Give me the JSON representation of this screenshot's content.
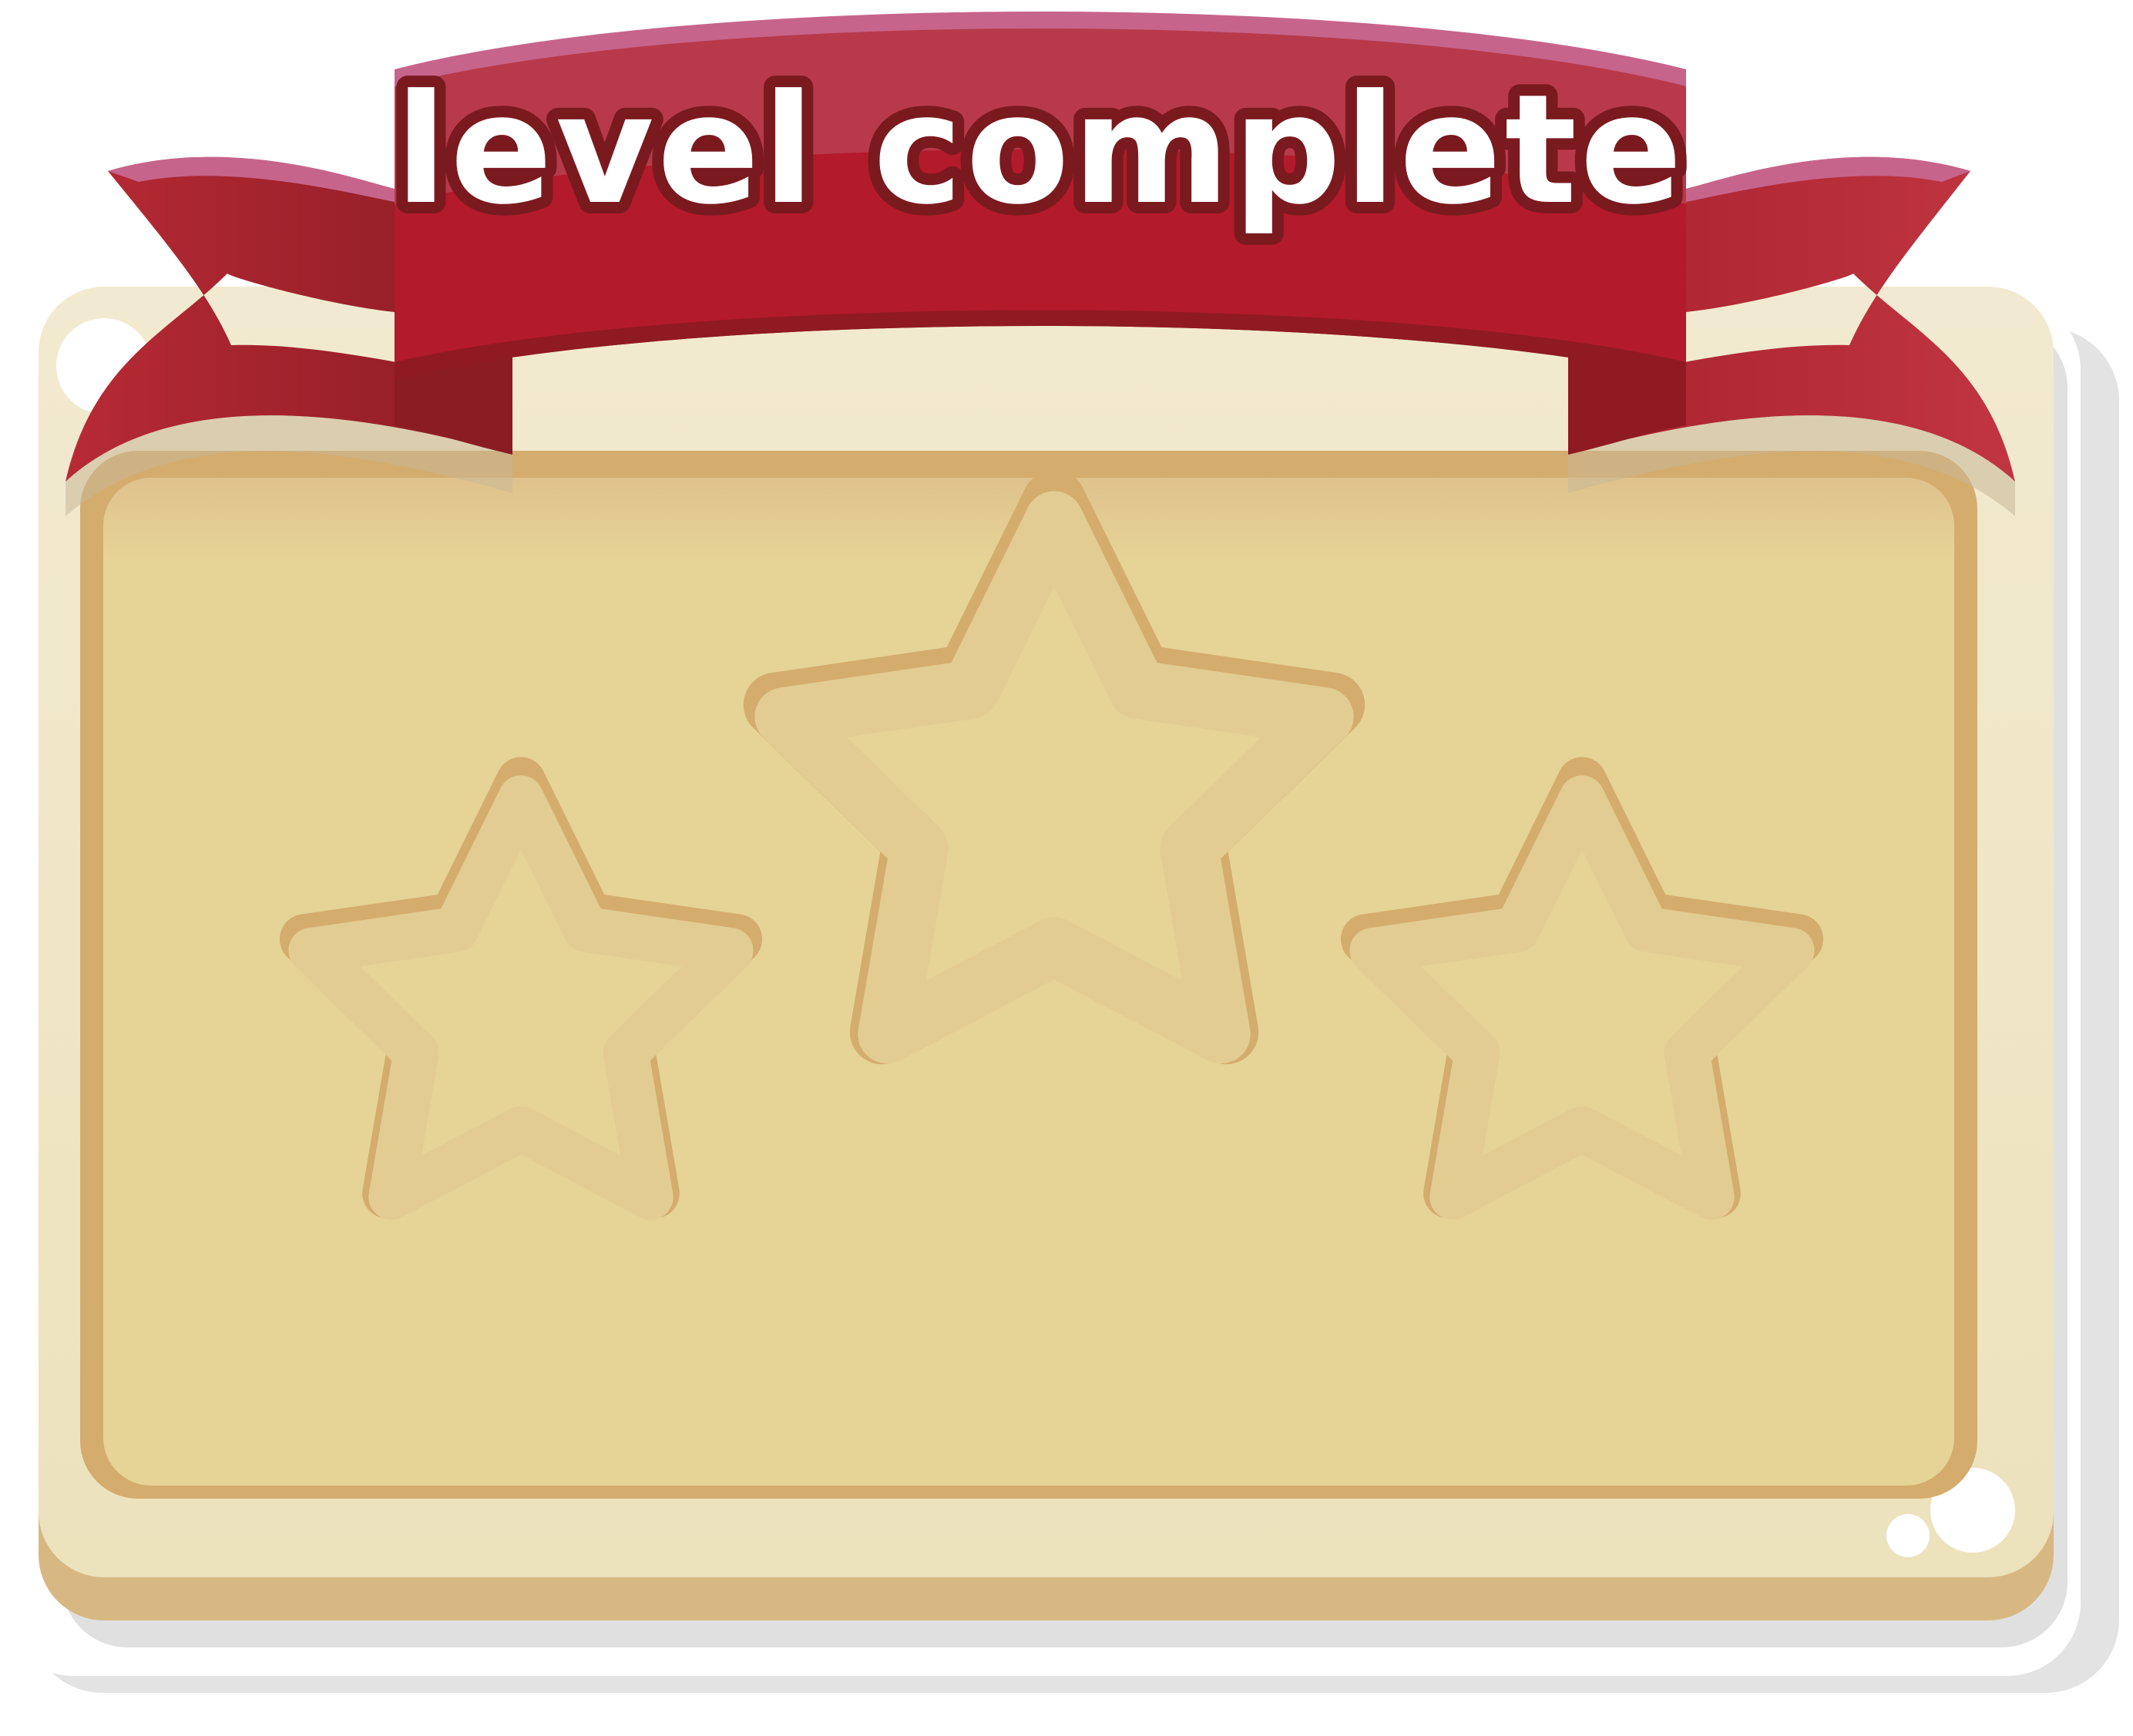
{
  "panel": {
    "title": "level complete"
  },
  "stars": {
    "total": 3,
    "earned": 0
  },
  "colors": {
    "ribbon_red": "#b31a2b",
    "ribbon_dark": "#8f1a22",
    "ribbon_pink": "#c7648c",
    "card_light": "#ede4c0",
    "card_inner": "#e6d496",
    "card_border": "#d4ac6e",
    "title_fill": "#ffffff",
    "title_outline": "#7a1a1f"
  },
  "icons": {
    "star_slot": "star-outline-icon",
    "banner": "ribbon-banner-icon"
  }
}
